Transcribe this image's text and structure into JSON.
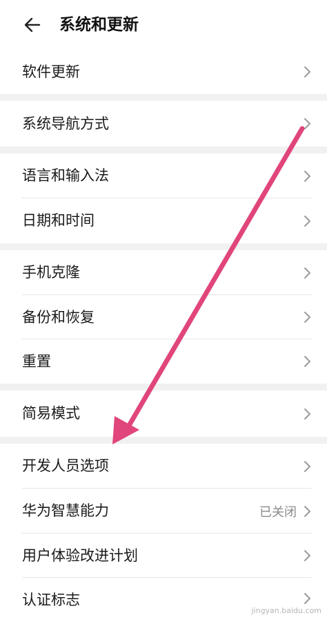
{
  "header": {
    "back_icon": "arrow-left-icon",
    "title": "系统和更新"
  },
  "chevron_icon": "chevron-right-icon",
  "items": [
    {
      "label": "软件更新"
    },
    {
      "label": "系统导航方式"
    },
    {
      "label": "语言和输入法"
    },
    {
      "label": "日期和时间"
    },
    {
      "label": "手机克隆"
    },
    {
      "label": "备份和恢复"
    },
    {
      "label": "重置"
    },
    {
      "label": "简易模式"
    },
    {
      "label": "开发人员选项"
    },
    {
      "label": "华为智慧能力",
      "status": "已关闭"
    },
    {
      "label": "用户体验改进计划"
    },
    {
      "label": "认证标志"
    }
  ],
  "annotation": {
    "arrow_color": "#e0457b"
  },
  "watermark": "jingyan.baidu.com"
}
